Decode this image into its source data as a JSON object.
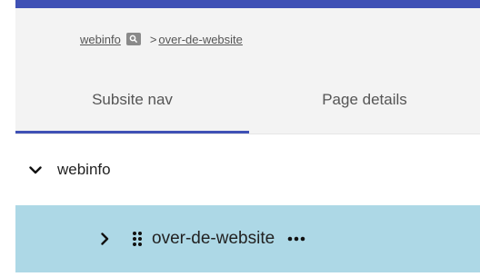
{
  "breadcrumb": {
    "root_label": "webinfo",
    "separator": ">",
    "current_label": "over-de-website"
  },
  "tabs": [
    {
      "label": "Subsite nav",
      "active": true
    },
    {
      "label": "Page details",
      "active": false
    }
  ],
  "tree": {
    "root": {
      "label": "webinfo",
      "expanded": true
    },
    "children": [
      {
        "label": "over-de-website",
        "expanded": false,
        "selected": true
      }
    ]
  },
  "colors": {
    "accent": "#3f51b5",
    "selected_row": "#add8e6",
    "header_bg": "#f3f3f3"
  },
  "icons": {
    "breadcrumb_search": "search-icon",
    "root_toggle": "chevron-down-icon",
    "child_toggle": "chevron-right-icon",
    "drag": "drag-handle-icon",
    "menu": "more-horizontal-icon"
  }
}
